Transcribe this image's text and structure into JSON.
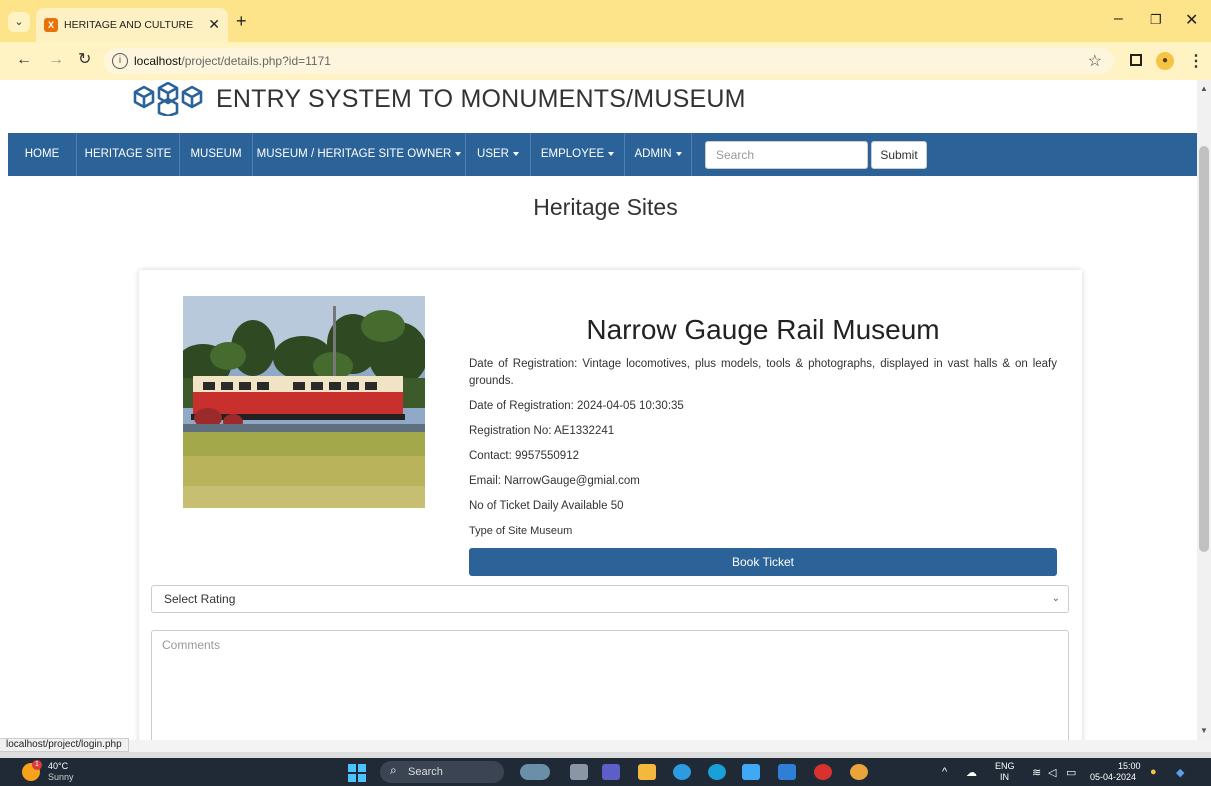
{
  "browser": {
    "tab_title": "HERITAGE AND CULTURE TICKE",
    "url_host": "localhost",
    "url_path": "/project/details.php?id=1171",
    "status_url": "localhost/project/login.php"
  },
  "site": {
    "title": "ENTRY SYSTEM TO MONUMENTS/MUSEUM"
  },
  "nav": {
    "items": [
      {
        "label": "HOME",
        "dropdown": false
      },
      {
        "label": "HERITAGE SITE",
        "dropdown": false
      },
      {
        "label": "MUSEUM",
        "dropdown": false
      },
      {
        "label": "MUSEUM / HERITAGE SITE OWNER",
        "dropdown": true
      },
      {
        "label": "USER",
        "dropdown": true
      },
      {
        "label": "EMPLOYEE",
        "dropdown": true
      },
      {
        "label": "ADMIN",
        "dropdown": true
      }
    ],
    "search_placeholder": "Search",
    "submit_label": "Submit"
  },
  "page": {
    "heading": "Heritage Sites"
  },
  "details": {
    "name": "Narrow Gauge Rail Museum",
    "description": "Date of Registration: Vintage locomotives, plus models, tools & photographs, displayed in vast halls & on leafy grounds.",
    "registration_date": "Date of Registration: 2024-04-05 10:30:35",
    "registration_no": "Registration No: AE1332241",
    "contact": "Contact: 9957550912",
    "email": "Email: NarrowGauge@gmial.com",
    "tickets": "No of Ticket Daily Available 50",
    "site_type": "Type of Site Museum",
    "book_label": "Book Ticket"
  },
  "feedback": {
    "rating_placeholder": "Select Rating",
    "comments_placeholder": "Comments"
  },
  "taskbar": {
    "temperature": "40°C",
    "weather": "Sunny",
    "weather_badge": "1",
    "search_label": "Search",
    "lang_top": "ENG",
    "lang_bottom": "IN",
    "time": "15:00",
    "date": "05-04-2024"
  }
}
